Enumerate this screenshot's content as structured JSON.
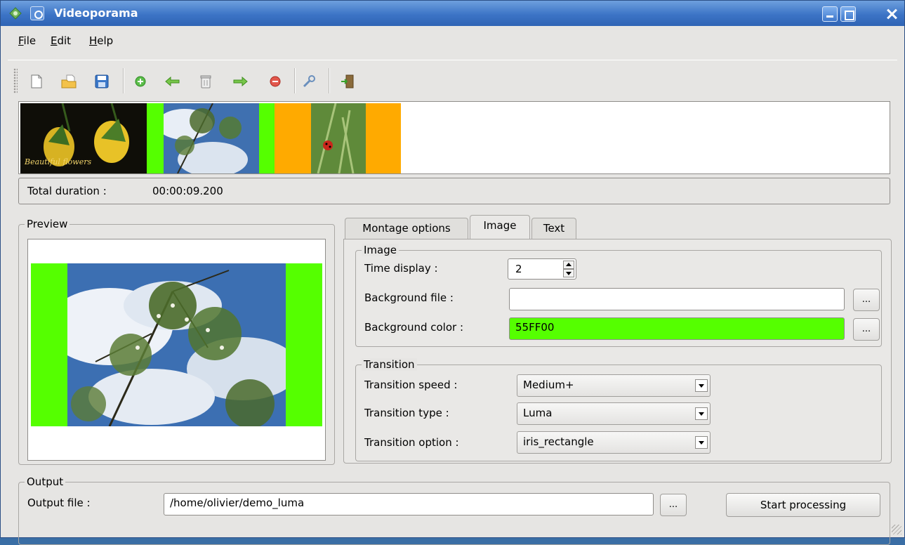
{
  "window": {
    "title": "Videoporama"
  },
  "menu": {
    "file": "File",
    "edit": "Edit",
    "help": "Help"
  },
  "toolbar": {
    "icons": [
      "new-file-icon",
      "open-folder-icon",
      "save-icon",
      "add-icon",
      "move-left-icon",
      "trash-icon",
      "move-right-icon",
      "remove-icon",
      "settings-wrench-icon",
      "exit-icon"
    ]
  },
  "timeline": {
    "thumbnails": [
      {
        "name": "flowers",
        "caption": "Beautiful flowers"
      },
      {
        "name": "sky-tree",
        "background": "#55FF00"
      },
      {
        "name": "ladybug",
        "background": "#FFAA00"
      }
    ]
  },
  "duration": {
    "label": "Total duration :",
    "value": "00:00:09.200"
  },
  "preview": {
    "title": "Preview"
  },
  "tabs": {
    "montage": "Montage options",
    "image": "Image",
    "text": "Text"
  },
  "image_group": {
    "title": "Image",
    "time_display_label": "Time display :",
    "time_display_value": "2",
    "background_file_label": "Background file :",
    "background_file_value": "",
    "background_color_label": "Background color :",
    "background_color_value": "55FF00",
    "browse": "..."
  },
  "transition_group": {
    "title": "Transition",
    "speed_label": "Transition speed :",
    "speed_value": "Medium+",
    "type_label": "Transition type :",
    "type_value": "Luma",
    "option_label": "Transition option :",
    "option_value": "iris_rectangle"
  },
  "output": {
    "title": "Output",
    "file_label": "Output file :",
    "file_value": "/home/olivier/demo_luma",
    "browse": "...",
    "start": "Start processing"
  },
  "colors": {
    "green": "#55FF00",
    "orange": "#FFAA00",
    "titlebar": "#3c74c6"
  }
}
